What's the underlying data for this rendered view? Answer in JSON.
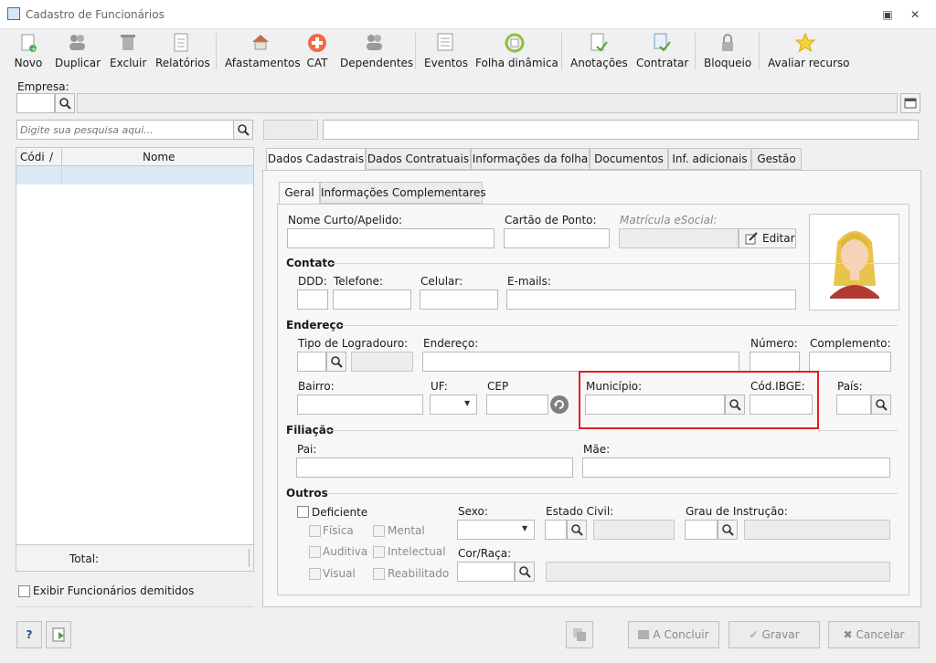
{
  "window": {
    "title": "Cadastro de Funcionários",
    "restore_glyph": "▣",
    "close_glyph": "✕"
  },
  "toolbar": [
    {
      "label": "Novo",
      "icon": "new-doc-icon"
    },
    {
      "label": "Duplicar",
      "icon": "users-icon"
    },
    {
      "label": "Excluir",
      "icon": "trash-icon"
    },
    {
      "label": "Relatórios",
      "icon": "report-icon"
    },
    {
      "label": "Afastamentos",
      "icon": "house-arrow-icon"
    },
    {
      "label": "CAT",
      "icon": "medical-cross-icon"
    },
    {
      "label": "Dependentes",
      "icon": "users-icon"
    },
    {
      "label": "Eventos",
      "icon": "list-icon"
    },
    {
      "label": "Folha dinâmica",
      "icon": "calendar-refresh-icon"
    },
    {
      "label": "Anotações",
      "icon": "note-check-icon"
    },
    {
      "label": "Contratar",
      "icon": "contract-check-icon"
    },
    {
      "label": "Bloqueio",
      "icon": "lock-icon"
    },
    {
      "label": "Avaliar recurso",
      "icon": "star-icon"
    }
  ],
  "empresa": {
    "label": "Empresa:",
    "code": "",
    "name": ""
  },
  "search": {
    "placeholder": "Digite sua pesquisa aqui...",
    "field1": "",
    "field2": ""
  },
  "grid": {
    "columns": [
      "Códi",
      "/",
      "Nome"
    ],
    "total_label": "Total:"
  },
  "show_dismissed": {
    "label": "Exibir Funcionários demitidos",
    "checked": false
  },
  "tabs": [
    "Dados Cadastrais",
    "Dados Contratuais",
    "Informações da folha",
    "Documentos",
    "Inf. adicionais",
    "Gestão"
  ],
  "active_tab": "Dados Cadastrais",
  "subtabs": [
    "Geral",
    "Informações Complementares"
  ],
  "active_subtab": "Geral",
  "form": {
    "nome_curto": {
      "label": "Nome Curto/Apelido:",
      "value": ""
    },
    "cartao_ponto": {
      "label": "Cartão de Ponto:",
      "value": ""
    },
    "matricula_esocial": {
      "label": "Matrícula eSocial:",
      "value": "",
      "edit_label": "Editar"
    },
    "contato": {
      "title": "Contato",
      "ddd": {
        "label": "DDD:",
        "value": ""
      },
      "telefone": {
        "label": "Telefone:",
        "value": ""
      },
      "celular": {
        "label": "Celular:",
        "value": ""
      },
      "emails": {
        "label": "E-mails:",
        "value": ""
      }
    },
    "endereco": {
      "title": "Endereço",
      "tipo_logradouro": {
        "label": "Tipo de Logradouro:",
        "value": ""
      },
      "endereco": {
        "label": "Endereço:",
        "value": ""
      },
      "numero": {
        "label": "Número:",
        "value": ""
      },
      "complemento": {
        "label": "Complemento:",
        "value": ""
      },
      "bairro": {
        "label": "Bairro:",
        "value": ""
      },
      "uf": {
        "label": "UF:",
        "value": ""
      },
      "cep": {
        "label": "CEP",
        "value": ""
      },
      "municipio": {
        "label": "Município:",
        "value": ""
      },
      "cod_ibge": {
        "label": "Cód.IBGE:",
        "value": ""
      },
      "pais": {
        "label": "País:",
        "value": ""
      }
    },
    "filiacao": {
      "title": "Filiação",
      "pai": {
        "label": "Pai:",
        "value": ""
      },
      "mae": {
        "label": "Mãe:",
        "value": ""
      }
    },
    "outros": {
      "title": "Outros",
      "deficiente": {
        "label": "Deficiente",
        "checked": false
      },
      "deficiencias": [
        "Física",
        "Mental",
        "Auditiva",
        "Intelectual",
        "Visual",
        "Reabilitado"
      ],
      "sexo": {
        "label": "Sexo:",
        "value": ""
      },
      "estado_civil": {
        "label": "Estado Civil:",
        "value": ""
      },
      "grau_instrucao": {
        "label": "Grau de Instrução:",
        "value": ""
      },
      "cor_raca": {
        "label": "Cor/Raça:",
        "value": ""
      }
    }
  },
  "buttons": {
    "help": "?",
    "concluir": "A Concluir",
    "gravar": "Gravar",
    "cancelar": "Cancelar"
  },
  "colors": {
    "highlight": "#e21d1d",
    "grid_selected_row": "#dbe9f6"
  }
}
